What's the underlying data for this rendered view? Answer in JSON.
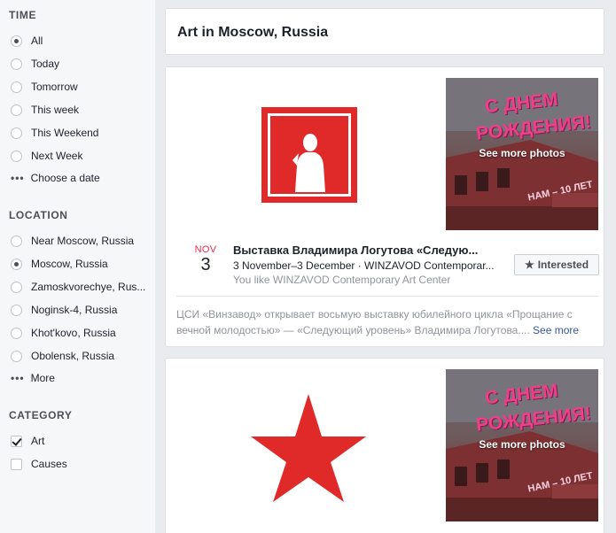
{
  "sidebar": {
    "time": {
      "title": "TIME",
      "options": [
        "All",
        "Today",
        "Tomorrow",
        "This week",
        "This Weekend",
        "Next Week"
      ],
      "selected": 0,
      "more": "Choose a date"
    },
    "location": {
      "title": "LOCATION",
      "options": [
        "Near Moscow, Russia",
        "Moscow, Russia",
        "Zamoskvorechye, Rus...",
        "Noginsk-4, Russia",
        "Khot'kovo, Russia",
        "Obolensk, Russia"
      ],
      "selected": 1,
      "more": "More"
    },
    "category": {
      "title": "CATEGORY",
      "options": [
        {
          "label": "Art",
          "checked": true
        },
        {
          "label": "Causes",
          "checked": false
        }
      ]
    }
  },
  "header": {
    "title": "Art in Moscow, Russia"
  },
  "events": [
    {
      "logo_color": "#e02a2a",
      "photo_banner_line1": "С ДНЕМ",
      "photo_banner_line2": "РОЖДЕНИЯ!",
      "photo_neon": "НАМ – 10 ЛЕТ",
      "see_photos": "See more photos",
      "month": "NOV",
      "day": "3",
      "title": "Выставка Владимира Логутова «Следую...",
      "dates_venue": "3 November–3 December · WINZAVOD Contemporar...",
      "social": "You like WINZAVOD Contemporary Art Center",
      "interested_label": "Interested",
      "description": "ЦСИ «Винзавод» открывает восьмую выставку юбилейного цикла «Прощание с вечной молодостью» — «Следующий уровень» Владимира Логутова....",
      "see_more": "See more"
    },
    {
      "logo_color": "#e02a2a",
      "photo_banner_line1": "С ДНЕМ",
      "photo_banner_line2": "РОЖДЕНИЯ!",
      "photo_neon": "НАМ – 10 ЛЕТ",
      "see_photos": "See more photos"
    }
  ]
}
